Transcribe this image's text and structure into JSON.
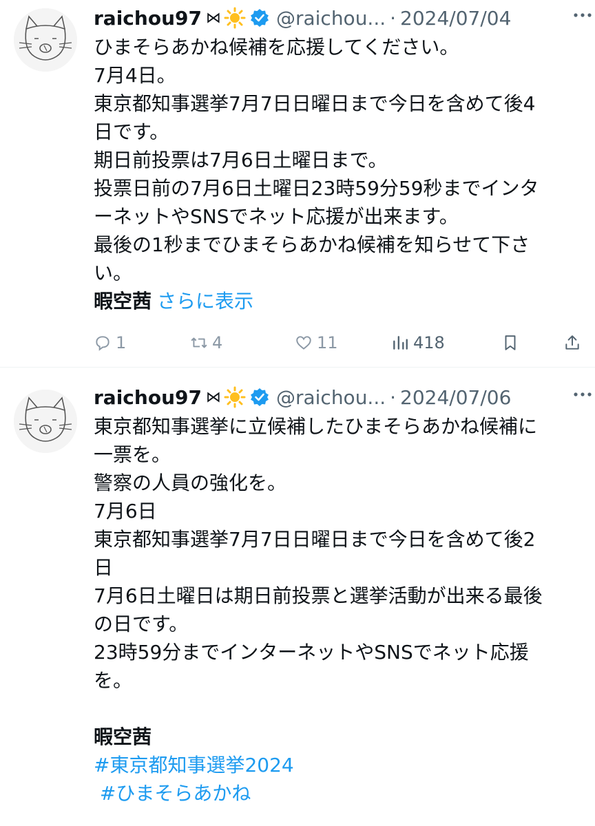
{
  "tweets": [
    {
      "author_name": "raichou97",
      "author_emoji": "⋈",
      "handle": "@raichou...",
      "separator": "·",
      "date": "2024/07/04",
      "lines": [
        "ひまそらあかね候補を応援してください。",
        "7月4日。",
        "東京都知事選挙7月7日日曜日まで今日を含めて後4",
        "日です。",
        "期日前投票は7月6日土曜日まで。",
        "投票日前の7月6日土曜日23時59分59秒までインタ",
        "ーネットやSNSでネット応援が出来ます。",
        "最後の1秒までひまそらあかね候補を知らせて下さ",
        "い。"
      ],
      "signature": "暇空茜",
      "show_more": "さらに表示",
      "replies": "1",
      "retweets": "4",
      "likes": "11",
      "views": "418"
    },
    {
      "author_name": "raichou97",
      "author_emoji": "⋈",
      "handle": "@raichou...",
      "separator": "·",
      "date": "2024/07/06",
      "lines": [
        "東京都知事選挙に立候補したひまそらあかね候補に",
        "一票を。",
        "警察の人員の強化を。",
        "7月6日",
        "東京都知事選挙7月7日日曜日まで今日を含めて後2",
        "日",
        "7月6日土曜日は期日前投票と選挙活動が出来る最後",
        "の日です。",
        "23時59分までインターネットやSNSでネット応援",
        "を。",
        ""
      ],
      "signature": "暇空茜",
      "hashtags": [
        "#東京都知事選挙2024",
        " #ひまそらあかね"
      ]
    }
  ],
  "colors": {
    "link": "#1d9bf0",
    "muted": "#536471",
    "text": "#0f1419",
    "verified": "#1d9bf0"
  },
  "icons": [
    "more-icon",
    "verified-icon",
    "sun-icon",
    "reply-icon",
    "retweet-icon",
    "like-icon",
    "views-icon",
    "bookmark-icon",
    "share-icon"
  ]
}
